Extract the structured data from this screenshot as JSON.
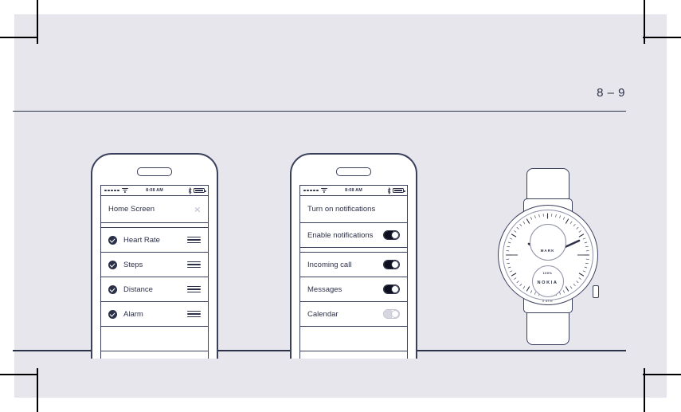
{
  "page": {
    "number_label": "8 – 9",
    "background_color": "#e7e6ed",
    "ink_color": "#2c3048",
    "accent_color": "#0e1020"
  },
  "crop_marks": {
    "top_left": "crop-mark",
    "top_right": "crop-mark",
    "bottom_left": "crop-mark",
    "bottom_right": "crop-mark"
  },
  "phone_1": {
    "device_name": "smartphone-mockup-left",
    "status_bar": {
      "carrier_dots": 5,
      "wifi": "wifi-icon",
      "time": "8:08 AM",
      "bluetooth": "bluetooth-icon",
      "battery": "battery-icon"
    },
    "header_row": {
      "label": "Home Screen",
      "chevron": "chevron-right-icon"
    },
    "items": [
      {
        "label": "Heart Rate",
        "checked": true,
        "handle": "drag-handle-icon"
      },
      {
        "label": "Steps",
        "checked": true,
        "handle": "drag-handle-icon"
      },
      {
        "label": "Distance",
        "checked": true,
        "handle": "drag-handle-icon"
      },
      {
        "label": "Alarm",
        "checked": true,
        "handle": "drag-handle-icon"
      }
    ]
  },
  "phone_2": {
    "device_name": "smartphone-mockup-right",
    "status_bar": {
      "carrier_dots": 5,
      "wifi": "wifi-icon",
      "time": "8:08 AM",
      "bluetooth": "bluetooth-icon",
      "battery": "battery-icon"
    },
    "header_row": {
      "label": "Turn on notifications"
    },
    "items": [
      {
        "label": "Enable notifications",
        "on": true
      },
      {
        "label": "Incoming call",
        "on": true
      },
      {
        "label": "Messages",
        "on": true
      },
      {
        "label": "Calendar",
        "on": false
      }
    ]
  },
  "watch": {
    "device_name": "analog-hybrid-watch",
    "brand": "NOKIA",
    "subdial_top_label": "MARK",
    "subdial_top_icon": "activity-swoosh-icon",
    "subdial_bottom_label": "100%",
    "water_resistance": "5 ATM",
    "band_top": "watch-band-top",
    "band_bottom": "watch-band-bottom",
    "crown": "watch-crown"
  }
}
